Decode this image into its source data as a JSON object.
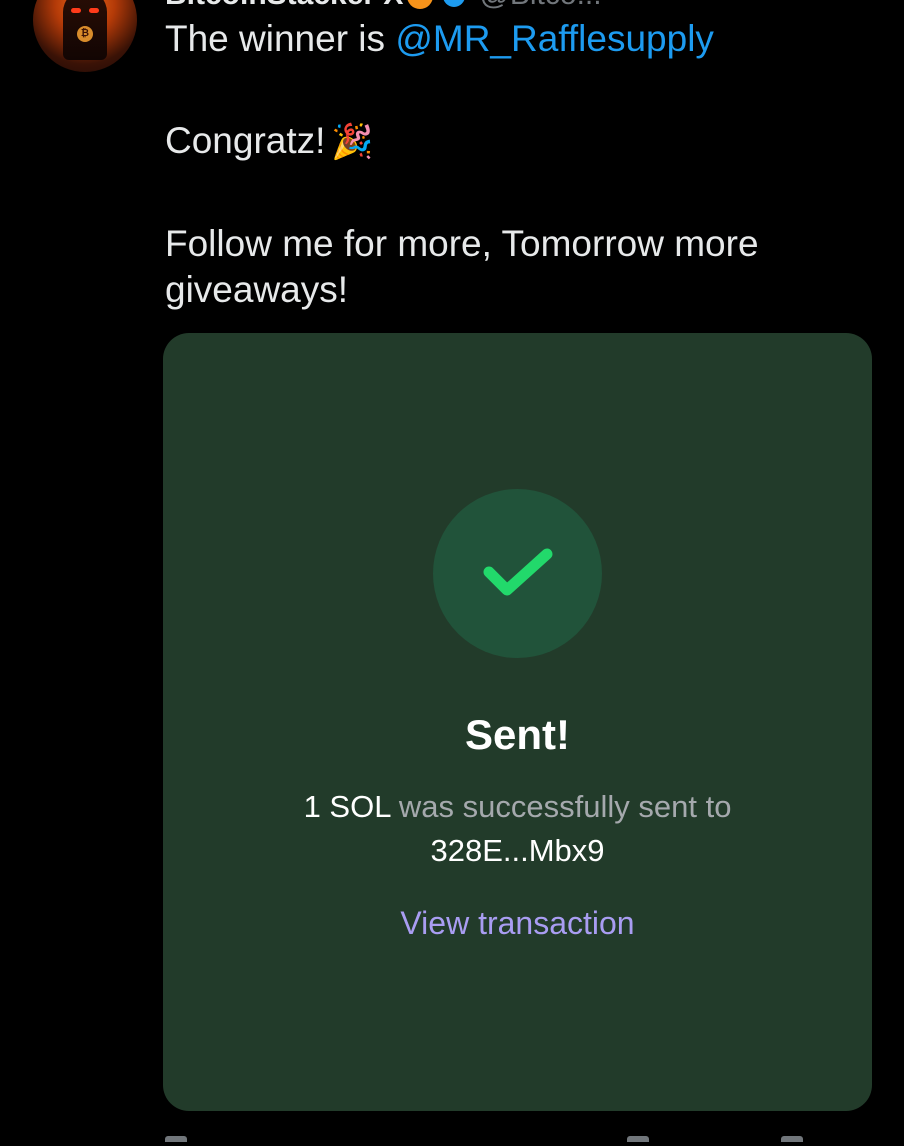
{
  "tweet": {
    "author_name": "BitcoinStacker X",
    "handle": "@Bitco...",
    "text_line1_prefix": "The winner is ",
    "mention": "@MR_Rafflesupply",
    "text_line2": "Congratz!",
    "text_line3": "Follow me for more, Tomorrow more giveaways!"
  },
  "card": {
    "title": "Sent!",
    "amount": "1 SOL",
    "desc_middle": " was successfully sent to",
    "address": "328E...Mbx9",
    "link_label": "View transaction"
  },
  "icons": {
    "avatar": "profile-avatar",
    "party": "party-popper-icon",
    "check": "checkmark-icon"
  },
  "colors": {
    "background": "#000000",
    "mention": "#1d9bf0",
    "card_bg": "#223b2a",
    "check_circle": "#21533a",
    "check": "#22d96b",
    "link": "#a99df2"
  }
}
